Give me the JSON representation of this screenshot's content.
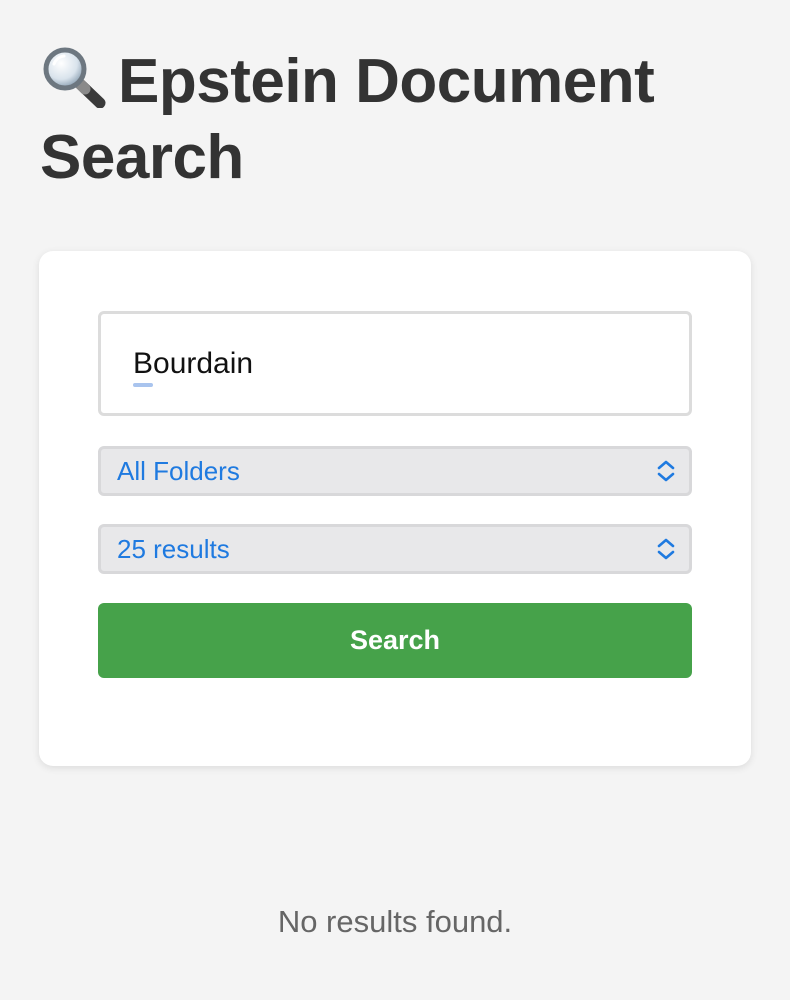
{
  "header": {
    "icon": "magnifying-glass-icon",
    "title": "Epstein Document Search"
  },
  "search_form": {
    "query_value": "Bourdain",
    "folder_select": {
      "selected": "All Folders",
      "icon": "chevron-up-down-icon"
    },
    "limit_select": {
      "selected": "25 results",
      "icon": "chevron-up-down-icon"
    },
    "submit_label": "Search"
  },
  "results": {
    "empty_message": "No results found."
  },
  "colors": {
    "background": "#f4f4f4",
    "card": "#ffffff",
    "button": "#46a24a",
    "select_text": "#1f7ae0",
    "title_text": "#333333"
  }
}
